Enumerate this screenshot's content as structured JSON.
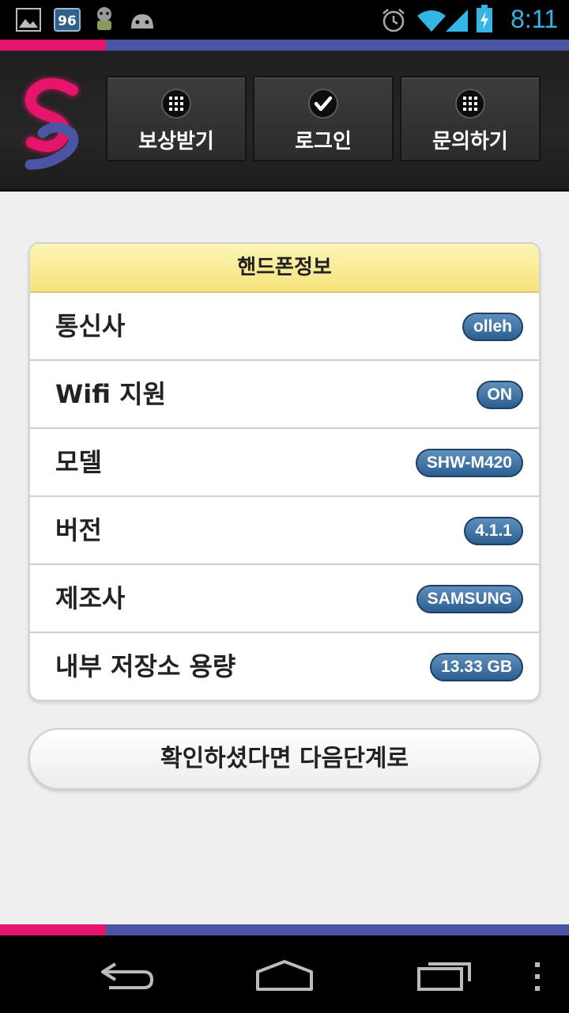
{
  "status_bar": {
    "time": "8:11",
    "icons": [
      "gallery-icon",
      "badge-96-icon",
      "notification-icon",
      "android-icon",
      "alarm-icon",
      "wifi-icon",
      "signal-icon",
      "battery-charging-icon"
    ],
    "badge_text": "96",
    "time_color": "#33b5e5"
  },
  "accent_colors": {
    "pink": "#e5156b",
    "blue": "#4a56a3"
  },
  "header": {
    "logo_icon": "s-logo-icon",
    "nav": [
      {
        "label": "보상받기",
        "icon": "grid-icon"
      },
      {
        "label": "로그인",
        "icon": "check-icon"
      },
      {
        "label": "문의하기",
        "icon": "grid-icon"
      }
    ]
  },
  "phone_info": {
    "title": "핸드폰정보",
    "rows": [
      {
        "label": "통신사",
        "value": "olleh"
      },
      {
        "label": "Wifi 지원",
        "value": "ON"
      },
      {
        "label": "모델",
        "value": "SHW-M420"
      },
      {
        "label": "버전",
        "value": "4.1.1"
      },
      {
        "label": "제조사",
        "value": "SAMSUNG"
      },
      {
        "label": "내부 저장소 용량",
        "value": "13.33 GB"
      }
    ]
  },
  "next_button": {
    "label": "확인하셨다면 다음단계로"
  },
  "system_nav": {
    "icons": [
      "back-icon",
      "home-icon",
      "recent-apps-icon",
      "menu-icon"
    ]
  }
}
